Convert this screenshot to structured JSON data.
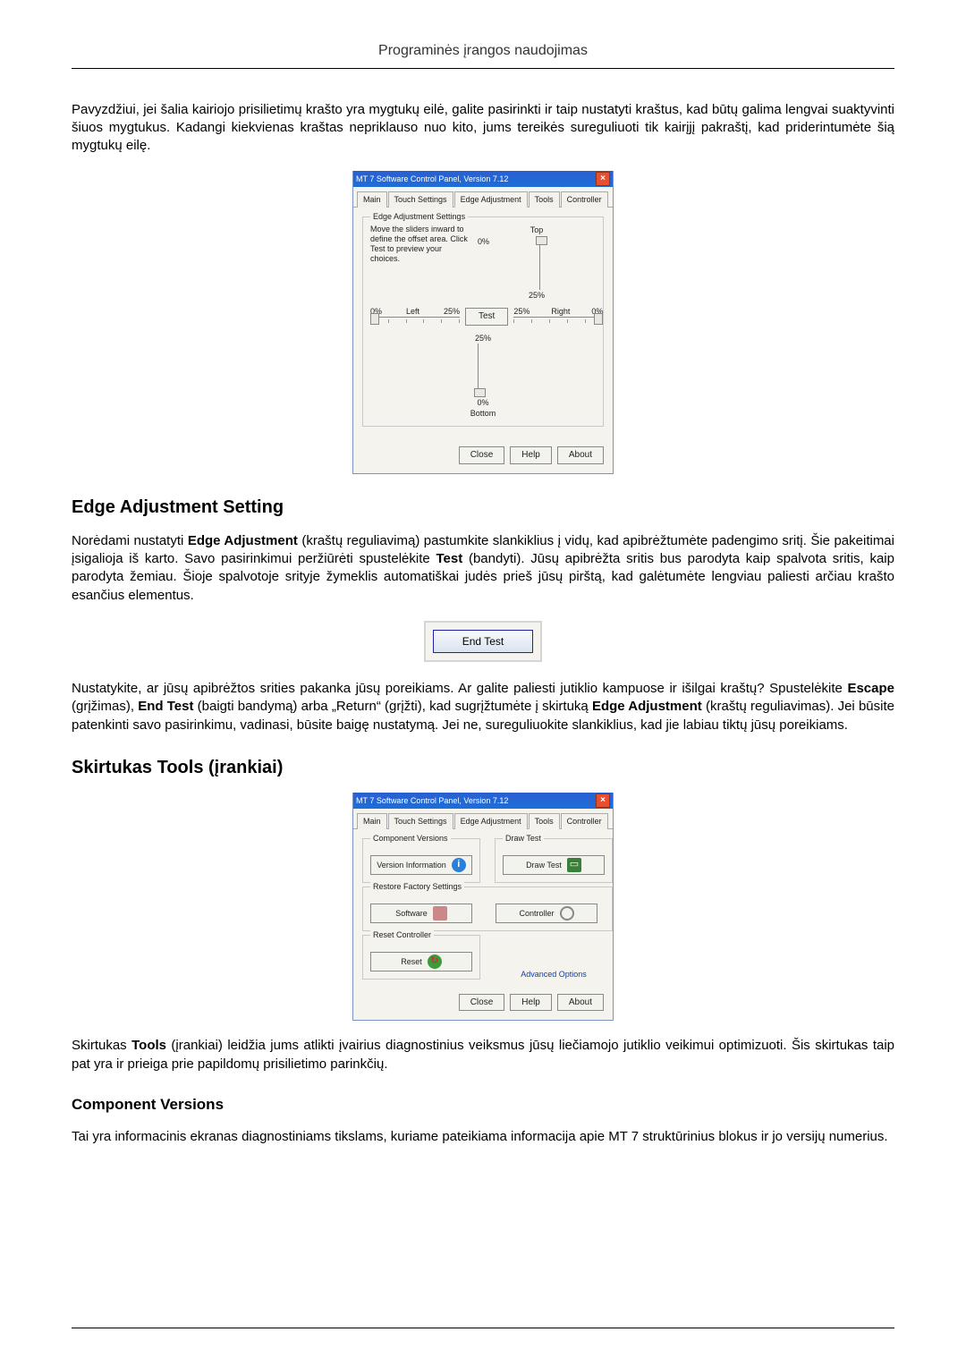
{
  "page_header": "Programinės įrangos naudojimas",
  "p1": "Pavyzdžiui, jei šalia kairiojo prisilietimų krašto yra mygtukų eilė, galite pasirinkti ir taip nustatyti kraštus, kad būtų galima lengvai suaktyvinti šiuos mygtukus. Kadangi kiekvienas kraštas nepriklauso nuo kito, jums tereikės sureguliuoti tik kairįjį pakraštį, kad priderintumėte šią mygtukų eilę.",
  "h_edge": "Edge Adjustment Setting",
  "p2_a": "Norėdami nustatyti ",
  "p2_b": " (kraštų reguliavimą) pastumkite slankiklius į vidų, kad apibrėžtumėte padengimo sritį. Šie pakeitimai įsigalioja iš karto. Savo pasirinkimui peržiūrėti spustelėkite ",
  "p2_c": " (bandyti). Jūsų apibrėžta sritis bus parodyta kaip spalvota sritis, kaip parodyta žemiau. Šioje spalvotoje srityje žymeklis automatiškai judės prieš jūsų pirštą, kad galėtumėte lengviau paliesti arčiau krašto esančius elementus.",
  "bold_edge_adj": "Edge Adjustment",
  "bold_test": "Test",
  "end_test_btn": "End Test",
  "p3_a": "Nustatykite, ar jūsų apibrėžtos srities pakanka jūsų poreikiams. Ar galite paliesti jutiklio kampuose ir išilgai kraštų? Spustelėkite ",
  "p3_b": " (grįžimas), ",
  "p3_c": " (baigti bandymą) arba „Return“ (grįžti), kad sugrįžtumėte į skirtuką ",
  "p3_d": " (kraštų reguliavimas). Jei būsite patenkinti savo pasirinkimu, vadinasi, būsite baigę nustatymą. Jei ne, sureguliuokite slankiklius, kad jie labiau tiktų jūsų poreikiams.",
  "bold_escape": "Escape",
  "bold_end_test": "End Test",
  "bold_edge_adj2": "Edge Adjustment",
  "h_tools": "Skirtukas Tools (įrankiai)",
  "p4_a": "Skirtukas ",
  "p4_b": " (įrankiai) leidžia jums atlikti įvairius diagnostinius veiksmus jūsų liečiamojo jutiklio veikimui optimizuoti. Šis skirtukas taip pat yra ir prieiga prie papildomų prisilietimo parinkčių.",
  "bold_tools": "Tools",
  "h_comp": "Component Versions",
  "p5": "Tai yra informacinis ekranas diagnostiniams tikslams, kuriame pateikiama informacija apie MT 7 struktūrinius blokus ir jo versijų numerius.",
  "win": {
    "title": "MT 7 Software Control Panel, Version 7.12",
    "close": "×",
    "tabs": {
      "main": "Main",
      "touch": "Touch Settings",
      "edge": "Edge Adjustment",
      "tools": "Tools",
      "ctrl": "Controller"
    },
    "btn_close": "Close",
    "btn_help": "Help",
    "btn_about": "About"
  },
  "edge_panel": {
    "group": "Edge Adjustment Settings",
    "hint": "Move the sliders inward to define the offset area. Click Test to preview your choices.",
    "top": "Top",
    "bottom": "Bottom",
    "left": "Left",
    "right": "Right",
    "pct0": "0%",
    "pct25": "25%",
    "test": "Test"
  },
  "tools_panel": {
    "g_versions": "Component Versions",
    "btn_versions": "Version Information",
    "g_draw": "Draw Test",
    "btn_draw": "Draw Test",
    "g_restore": "Restore Factory Settings",
    "btn_sw": "Software",
    "btn_ctrl": "Controller",
    "g_reset": "Reset Controller",
    "btn_reset": "Reset",
    "advanced": "Advanced Options"
  }
}
